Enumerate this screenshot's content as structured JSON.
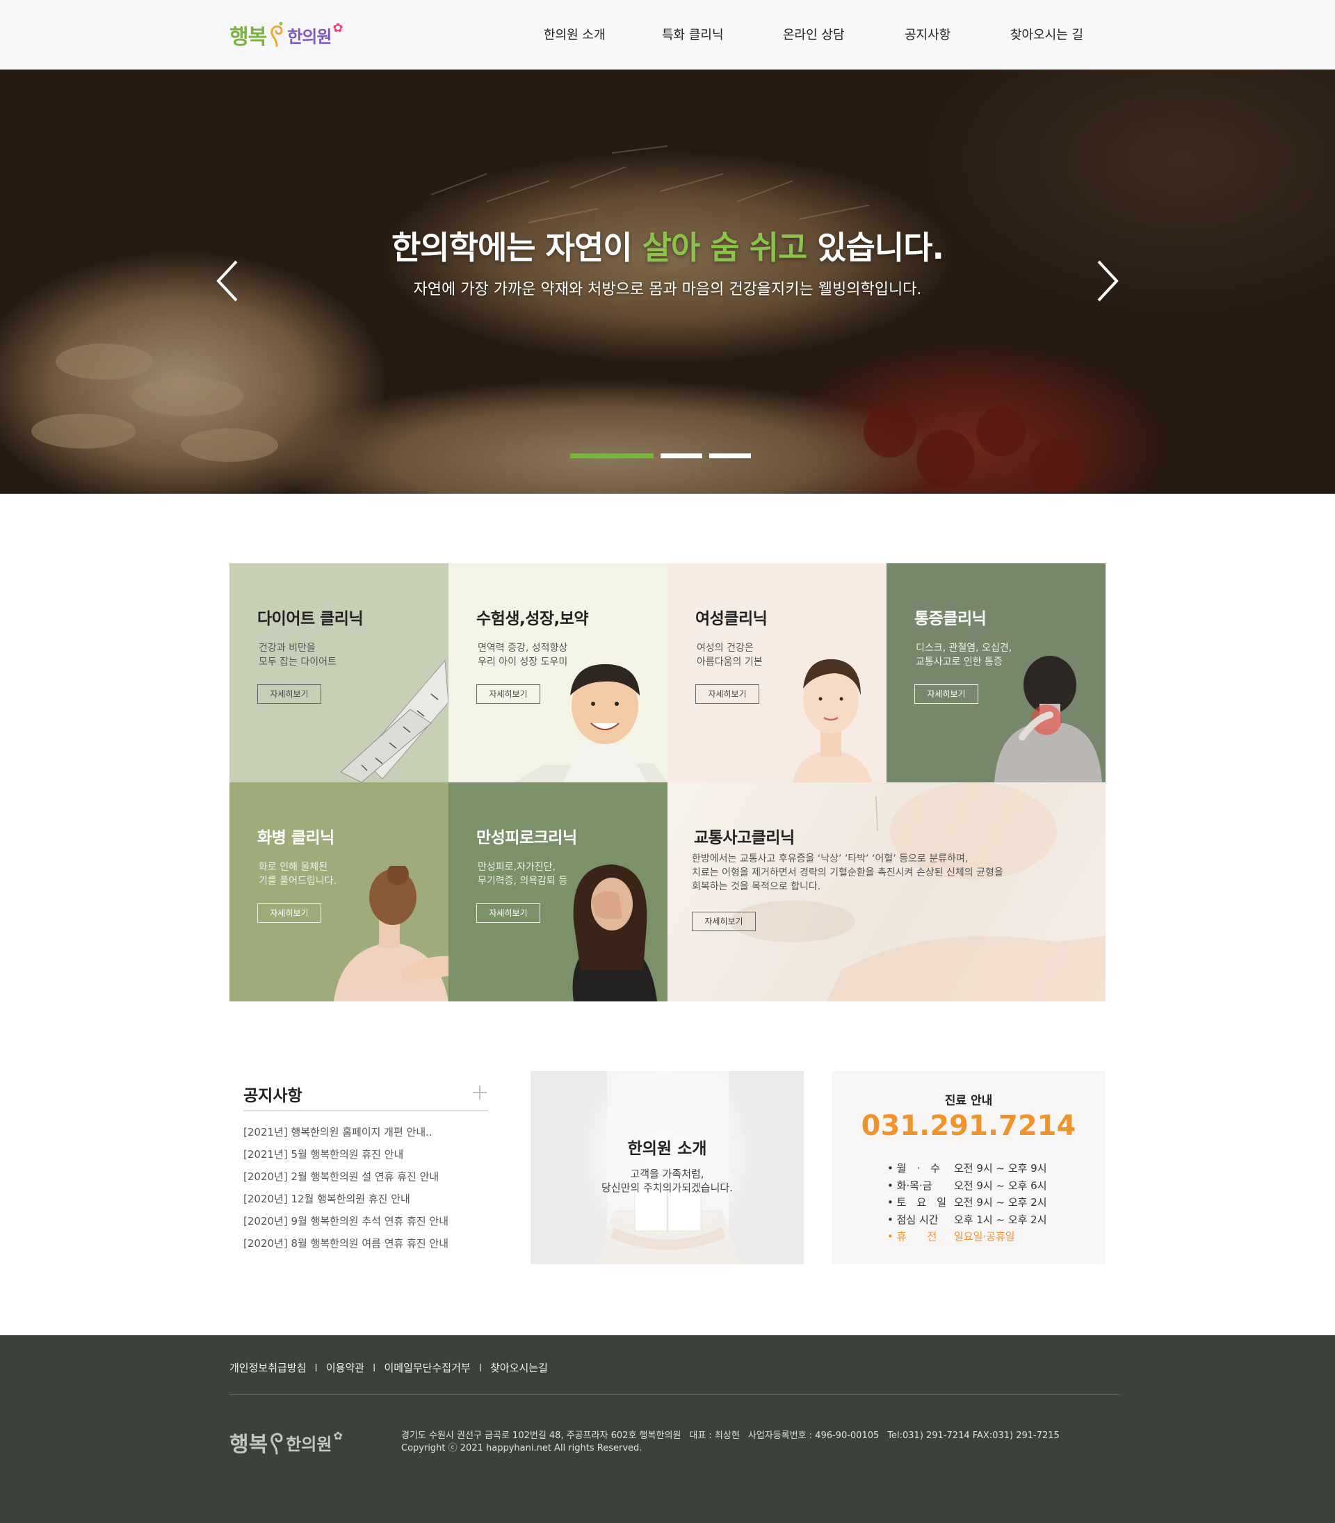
{
  "logo": {
    "text1": "행복",
    "text2": "한의원"
  },
  "nav": [
    "한의원 소개",
    "특화 클리닉",
    "온라인 상담",
    "공지사항",
    "찾아오시는 길"
  ],
  "hero": {
    "title_before": "한의학에는 자연이 ",
    "title_highlight": "살아 숨 쉬고",
    "title_after": " 있습니다.",
    "subtitle": "자연에 가장 가까운 약재와 처방으로 몸과 마음의 건강을지키는 웰빙의학입니다.",
    "slide_count": 3,
    "active_slide": 1
  },
  "clinics": [
    {
      "title": "다이어트 클리닉",
      "desc": "건강과 비만을\n모두 잡는 다이어트",
      "button": "자세히보기"
    },
    {
      "title": "수험생,성장,보약",
      "desc": "면역력 증강, 성적향상\n우리 아이 성장 도우미",
      "button": "자세히보기"
    },
    {
      "title": "여성클리닉",
      "desc": "여성의 건강은\n아름다움의 기본",
      "button": "자세히보기"
    },
    {
      "title": "통증클리닉",
      "desc": "디스크, 관절염, 오십견,\n교통사고로 인한 통증",
      "button": "자세히보기"
    },
    {
      "title": "화병 클리닉",
      "desc": "화로 인해 울체된\n기를 풀어드립니다.",
      "button": "자세히보기"
    },
    {
      "title": "만성피로크리닉",
      "desc": "만성피로,자가진단,\n무기력증, 의욕감퇴 등",
      "button": "자세히보기"
    },
    {
      "title": "교통사고클리닉",
      "desc": "한방에서는 교통사고 후유증을 ‘낙상’ ’타박’ ‘어혈’ 등으로 분류하며,\n치료는 어형을 제거하면서 경락의 기혈순환을 촉진시켜 손상된 신체의 균형을\n회복하는 것을 목적으로 합니다.",
      "button": "자세히보기"
    }
  ],
  "notice": {
    "title": "공지사항",
    "items": [
      "[2021년] 행복한의원 홈페이지 개편 안내..",
      "[2021년] 5월 행복한의원 휴진 안내",
      "[2020년] 2월 행복한의원 설 연휴 휴진 안내",
      "[2020년] 12월 행복한의원 휴진 안내",
      "[2020년] 9월 행복한의원 추석 연휴 휴진 안내",
      "[2020년] 8월 행복한의원 여름 연휴 휴진 안내"
    ]
  },
  "intro": {
    "title": "한의원 소개",
    "desc": "고객을 가족처럼,\n당신만의 주치의가되겠습니다."
  },
  "hours": {
    "title": "진료 안내",
    "phone": "031.291.7214",
    "rows": [
      {
        "day": "• 월　·　수",
        "time": "오전 9시 ~ 오후 9시"
      },
      {
        "day": "• 화·목·금",
        "time": "오전 9시 ~ 오후 6시"
      },
      {
        "day": "• 토　요　일",
        "time": "오전 9시 ~ 오후 2시"
      },
      {
        "day": "• 점심 시간",
        "time": "오후 1시 ~ 오후 2시"
      },
      {
        "day": "• 휴　　전",
        "time": "일요일·공휴일"
      }
    ]
  },
  "footer": {
    "links": [
      "개인정보취급방침",
      "이용약관",
      "이메일무단수집거부",
      "찾아오시는길"
    ],
    "address": "경기도 수원시 권선구 금곡로 102번길 48, 주공프라자 602호 행복한의원",
    "ceo": "대표 : 최상현",
    "biz": "사업자등록번호 : 496-90-00105",
    "tel": "Tel:031) 291-7214  FAX:031) 291-7215",
    "copyright": "Copyright ⓒ 2021 happyhani.net All rights Reserved."
  },
  "colors": {
    "brand_green": "#7cb342",
    "accent_orange": "#f0932b",
    "footer_bg": "#3c4239"
  }
}
